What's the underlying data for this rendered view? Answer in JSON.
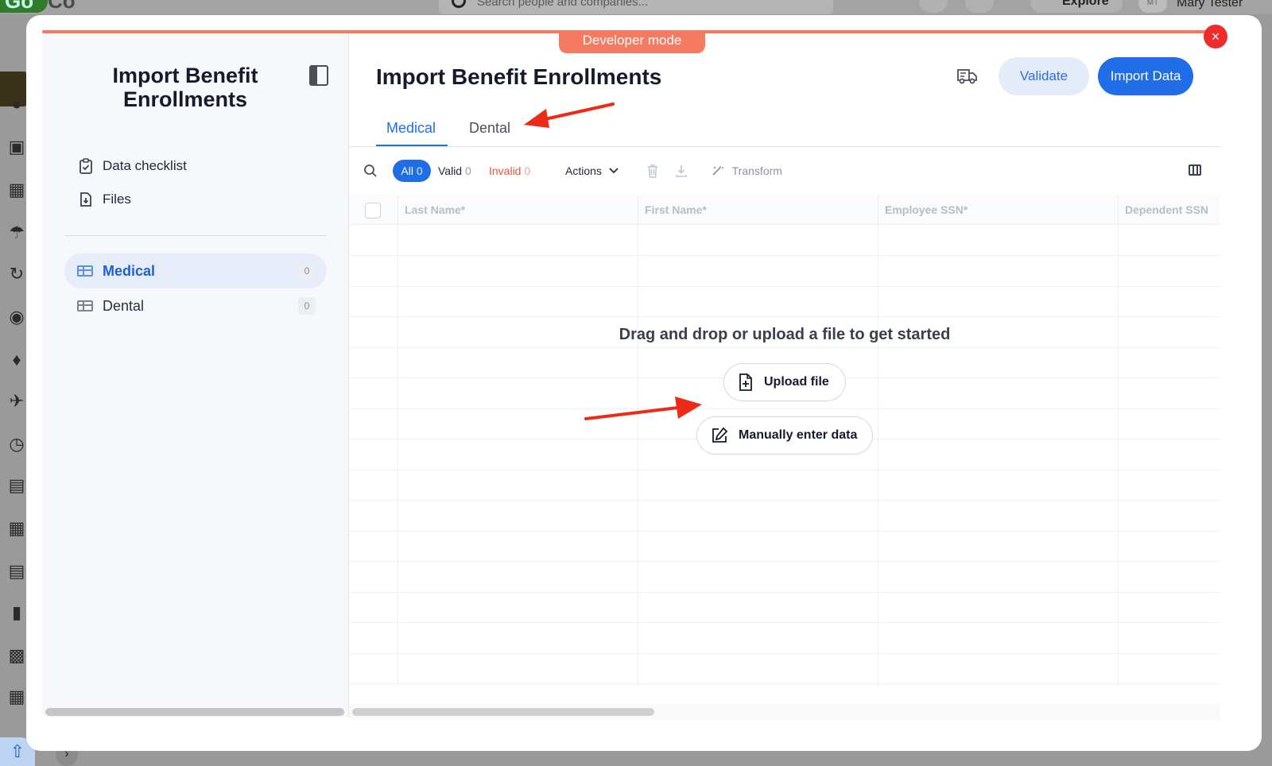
{
  "background_app": {
    "search_placeholder": "Search people and companies...",
    "explore_label": "Explore",
    "user_name": "Mary Tester",
    "user_initials": "MT",
    "logo_text": "Go",
    "logo_text_2": "Co"
  },
  "modal": {
    "developer_mode_label": "Developer mode",
    "close_icon": "×"
  },
  "sidebar": {
    "title": "Import Benefit Enrollments",
    "links": [
      {
        "label": "Data checklist",
        "icon": "clipboard-check-icon"
      },
      {
        "label": "Files",
        "icon": "file-download-icon"
      }
    ],
    "sheets": [
      {
        "label": "Medical",
        "count": "0",
        "active": true
      },
      {
        "label": "Dental",
        "count": "0",
        "active": false
      }
    ]
  },
  "header": {
    "title": "Import Benefit Enrollments",
    "validate_label": "Validate",
    "import_label": "Import Data"
  },
  "tabs": [
    {
      "label": "Medical",
      "active": true
    },
    {
      "label": "Dental",
      "active": false
    }
  ],
  "toolbar": {
    "all_label": "All",
    "all_count": "0",
    "valid_label": "Valid",
    "valid_count": "0",
    "invalid_label": "Invalid",
    "invalid_count": "0",
    "actions_label": "Actions",
    "transform_label": "Transform"
  },
  "grid": {
    "columns": [
      "Last Name*",
      "First Name*",
      "Employee SSN*",
      "Dependent SSN"
    ]
  },
  "empty_state": {
    "message": "Drag and drop or upload a file to get started",
    "upload_label": "Upload file",
    "manual_label": "Manually enter data"
  },
  "colors": {
    "accent": "#1f6ee8",
    "developer_mode": "#f47a62",
    "invalid": "#e5533d",
    "close": "#ef2b2b"
  }
}
